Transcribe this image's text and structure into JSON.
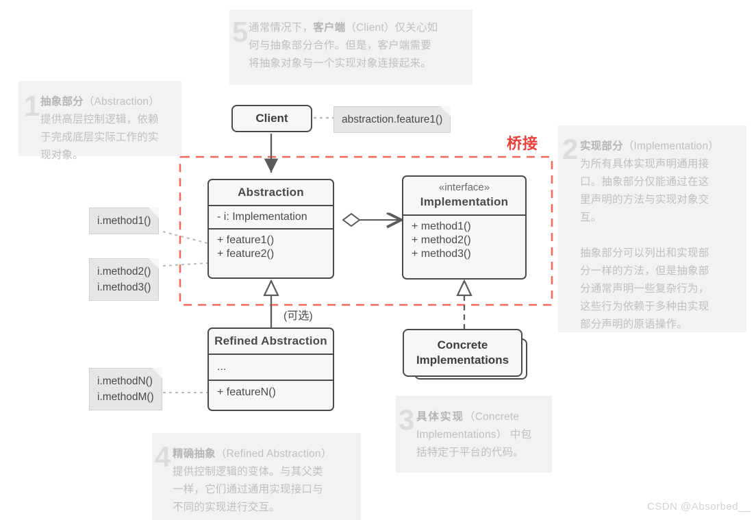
{
  "diagram": {
    "title_label": "桥接",
    "optional_label": "(可选)",
    "watermark": "CSDN @Absorbed__"
  },
  "classes": {
    "client": {
      "name": "Client"
    },
    "abstraction": {
      "name": "Abstraction",
      "fields": [
        "- i: Implementation"
      ],
      "methods": [
        "+ feature1()",
        "+ feature2()"
      ]
    },
    "implementation": {
      "stereotype": "«interface»",
      "name": "Implementation",
      "methods": [
        "+ method1()",
        "+ method2()",
        "+ method3()"
      ]
    },
    "refined_abstraction": {
      "name": "Refined Abstraction",
      "fields": [
        "..."
      ],
      "methods": [
        "+ featureN()"
      ]
    },
    "concrete_implementations": {
      "name_line1": "Concrete",
      "name_line2": "Implementations"
    }
  },
  "memos": {
    "client_call": "abstraction.feature1()",
    "method1": "i.method1()",
    "method23_line1": "i.method2()",
    "method23_line2": "i.method3()",
    "methodNM_line1": "i.methodN()",
    "methodNM_line2": "i.methodM()"
  },
  "annotations": {
    "n1": {
      "number": "1",
      "title": "抽象部分",
      "title_en": "（Abstraction）",
      "lines": [
        "提供高层控制逻辑，依赖",
        "于完成底层实际工作的实",
        "现对象。"
      ]
    },
    "n2": {
      "number": "2",
      "title": "实现部分",
      "title_en": "（Implementation）",
      "lines": [
        "为所有具体实现声明通用接",
        "口。抽象部分仅能通过在这",
        "里声明的方法与实现对象交",
        "互。"
      ],
      "lines2": [
        "抽象部分可以列出和实现部",
        "分一样的方法，但是抽象部",
        "分通常声明一些复杂行为，",
        "这些行为依赖于多种由实现",
        "部分声明的原语操作。"
      ]
    },
    "n3": {
      "number": "3",
      "title": "具体实现",
      "title_en": "（Concrete",
      "lines": [
        "Implementations） 中包",
        "括特定于平台的代码。"
      ]
    },
    "n4": {
      "number": "4",
      "title": "精确抽象",
      "title_en": "（Refined Abstraction）",
      "lines": [
        "提供控制逻辑的变体。与其父类",
        "一样，它们通过通用实现接口与",
        "不同的实现进行交互。"
      ]
    },
    "n5": {
      "number": "5",
      "pre": "通常情况下，",
      "title": "客户端",
      "title_en": "（Client）仅关心如",
      "lines": [
        "何与抽象部分合作。但是，客户端需要",
        "将抽象对象与一个实现对象连接起来。"
      ]
    }
  },
  "colors": {
    "accent_red": "#e8413c",
    "box_border": "#4a4a4a",
    "box_fill": "#f7f7f7",
    "note_fill": "#f2f2f2",
    "note_text": "#bfbfbf",
    "memo_fill": "#e6e6e6"
  }
}
